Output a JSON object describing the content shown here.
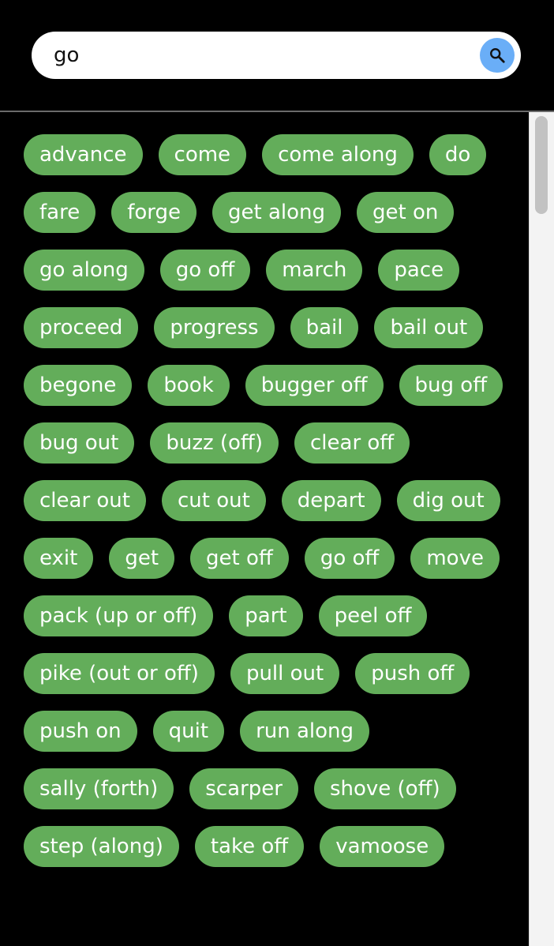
{
  "search": {
    "value": "go",
    "icon": "search-icon",
    "button_color": "#6aaef7"
  },
  "colors": {
    "chip_background": "#63ad5a",
    "chip_text": "#ffffff",
    "page_background": "#000000"
  },
  "synonyms": [
    "advance",
    "come",
    "come along",
    "do",
    "fare",
    "forge",
    "get along",
    "get on",
    "go along",
    "go off",
    "march",
    "pace",
    "proceed",
    "progress",
    "bail",
    "bail out",
    "begone",
    "book",
    "bugger off",
    "bug off",
    "bug out",
    "buzz (off)",
    "clear off",
    "clear out",
    "cut out",
    "depart",
    "dig out",
    "exit",
    "get",
    "get off",
    "go off",
    "move",
    "pack (up or off)",
    "part",
    "peel off",
    "pike (out or off)",
    "pull out",
    "push off",
    "push on",
    "quit",
    "run along",
    "sally (forth)",
    "scarper",
    "shove (off)",
    "step (along)",
    "take off",
    "vamoose"
  ]
}
